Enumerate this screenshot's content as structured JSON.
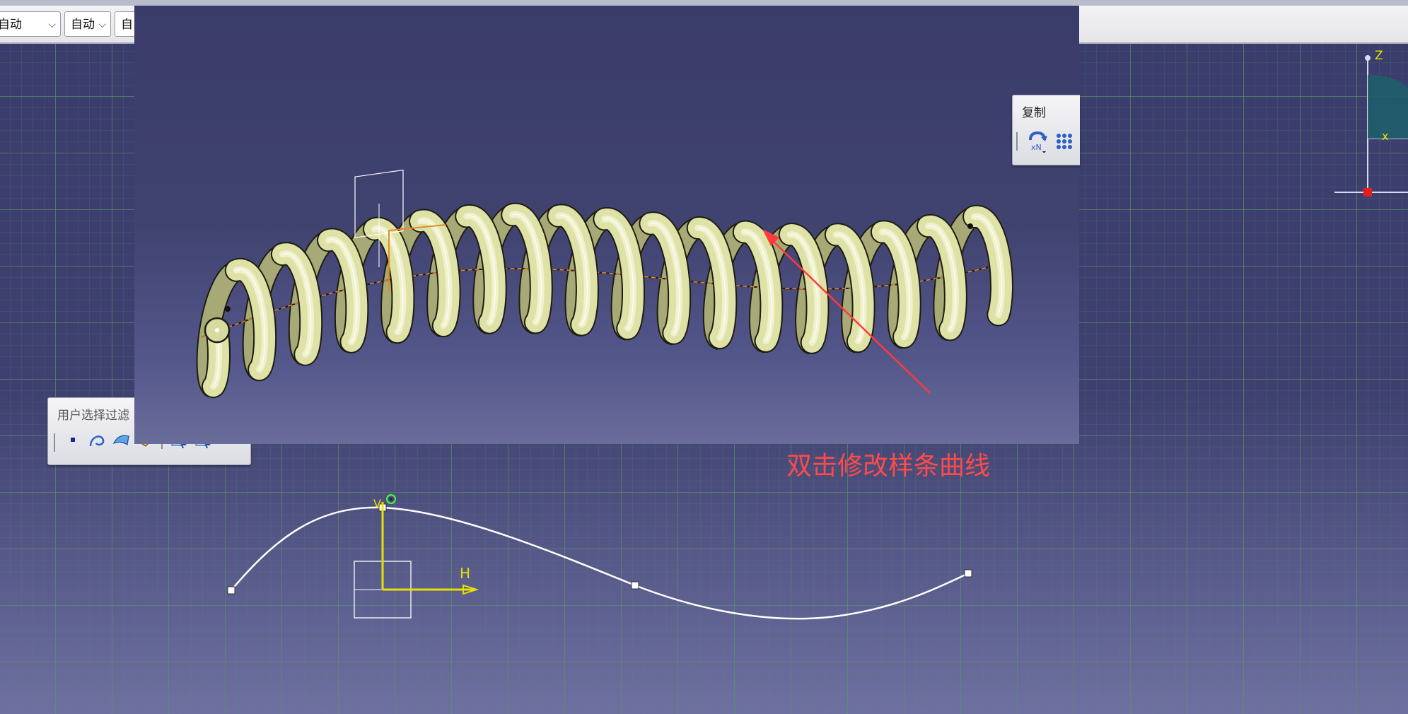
{
  "top_bar": {
    "dropdown1": "自动",
    "dropdown2": "自动",
    "dropdown3": "自"
  },
  "copy_toolbar": {
    "title": "复制",
    "repeat_label": "xN"
  },
  "filter_toolbar": {
    "title": "用户选择过滤"
  },
  "annotation": {
    "text": "双击修改样条曲线",
    "color": "#ff4a4a"
  },
  "sketch_axes": {
    "h_label": "H",
    "v_label": "V"
  },
  "compass": {
    "z_label": "Z",
    "x_label": "x"
  },
  "colors": {
    "spring": "#dfe2a6",
    "spline": "#ffffff",
    "axis": "#e6e000",
    "background": "#3b3d6b"
  }
}
